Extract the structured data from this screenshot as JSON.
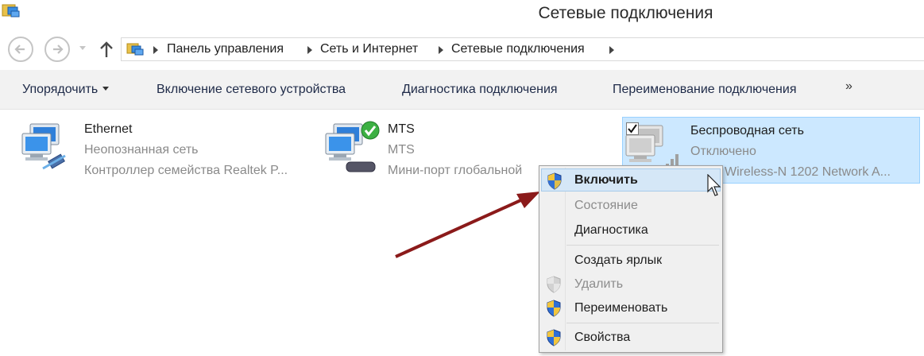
{
  "window": {
    "title": "Сетевые подключения"
  },
  "navigation": {
    "back_icon": "back-arrow-icon",
    "forward_icon": "forward-arrow-icon",
    "up_icon": "up-arrow-icon",
    "breadcrumbs": [
      "Панель управления",
      "Сеть и Интернет",
      "Сетевые подключения"
    ]
  },
  "toolbar": {
    "organize": "Упорядочить",
    "enable_device": "Включение сетевого устройства",
    "diagnose": "Диагностика подключения",
    "rename": "Переименование подключения",
    "more": "»"
  },
  "connections": [
    {
      "name": "Ethernet",
      "status": "Неопознанная сеть",
      "device": "Контроллер семейства Realtek P..."
    },
    {
      "name": "MTS",
      "status": "MTS",
      "device": "Мини-порт глобальной"
    },
    {
      "name": "Беспроводная сеть",
      "status": "Отключено",
      "device": "Wireless-N 1202 Network A...",
      "selected": true
    }
  ],
  "context_menu": {
    "items": [
      {
        "label": "Включить",
        "shield": true,
        "hover": true
      },
      {
        "label": "Состояние",
        "disabled": true
      },
      {
        "label": "Диагностика"
      },
      {
        "label": "Создать ярлык"
      },
      {
        "label": "Удалить",
        "shield": true,
        "disabled": true
      },
      {
        "label": "Переименовать",
        "shield": true
      },
      {
        "label": "Свойства",
        "shield": true
      }
    ]
  },
  "colors": {
    "selection_bg": "#cce8ff",
    "toolbar_bg": "#f2f2f2",
    "menu_bg": "#f0f0f0",
    "arrow": "#8b1a1a"
  }
}
